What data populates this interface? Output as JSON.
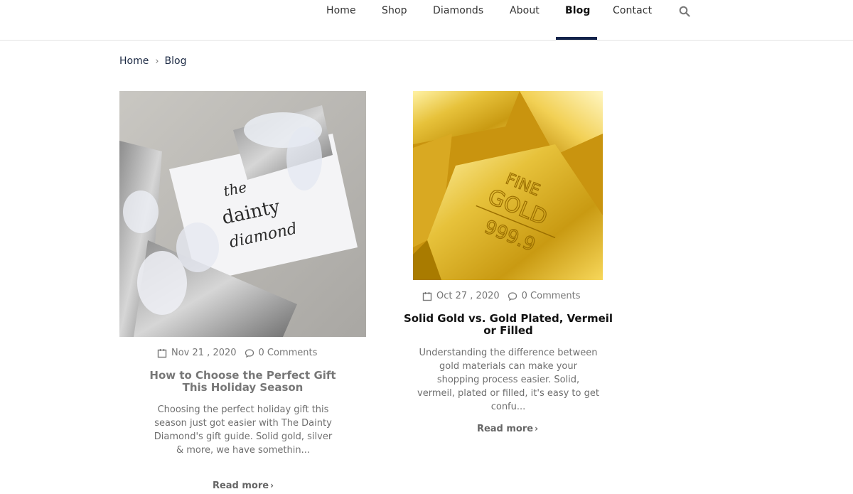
{
  "nav": {
    "items": [
      {
        "label": "Home"
      },
      {
        "label": "Shop"
      },
      {
        "label": "Diamonds"
      },
      {
        "label": "About"
      },
      {
        "label": "Blog",
        "active": true
      },
      {
        "label": "Contact"
      }
    ],
    "search_icon": "search-icon",
    "accent_color": "#13234a"
  },
  "breadcrumb": {
    "home": "Home",
    "separator": "›",
    "current": "Blog"
  },
  "posts": [
    {
      "date": "Nov 21 , 2020",
      "comments": "0 Comments",
      "title": "How to Choose the Perfect Gift This Holiday Season",
      "excerpt": "Choosing the perfect holiday gift this season just got easier with The Dainty Diamond's gift guide. Solid gold, silver & more, we have somethin...",
      "read_more": "Read more",
      "image_text": [
        "the",
        "dainty",
        "diamond"
      ],
      "title_color": "#777777"
    },
    {
      "date": "Oct 27 , 2020",
      "comments": "0 Comments",
      "title": "Solid Gold vs. Gold Plated, Vermeil or Filled",
      "excerpt": "Understanding the difference between gold materials can make your shopping process easier. Solid, vermeil, plated or filled, it's easy to get confu...",
      "read_more": "Read more",
      "image_text": [
        "FINE",
        "GOLD",
        "999.9"
      ],
      "title_color": "#111111"
    }
  ]
}
